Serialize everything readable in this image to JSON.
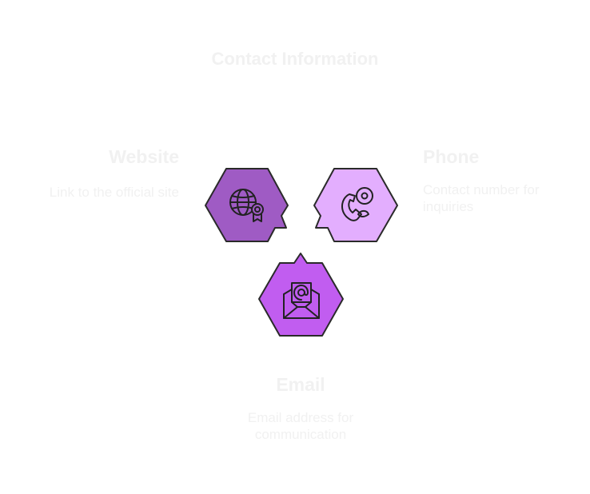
{
  "title": "Contact Information",
  "items": {
    "website": {
      "label": "Website",
      "description": "Link to the official site",
      "color": "#9f5bc4",
      "icon": "globe-award-icon"
    },
    "phone": {
      "label": "Phone",
      "description": "Contact number for inquiries",
      "color": "#e3aefe",
      "icon": "phone-icon"
    },
    "email": {
      "label": "Email",
      "description": "Email address for communication",
      "color": "#c15df0",
      "icon": "email-envelope-icon"
    }
  }
}
